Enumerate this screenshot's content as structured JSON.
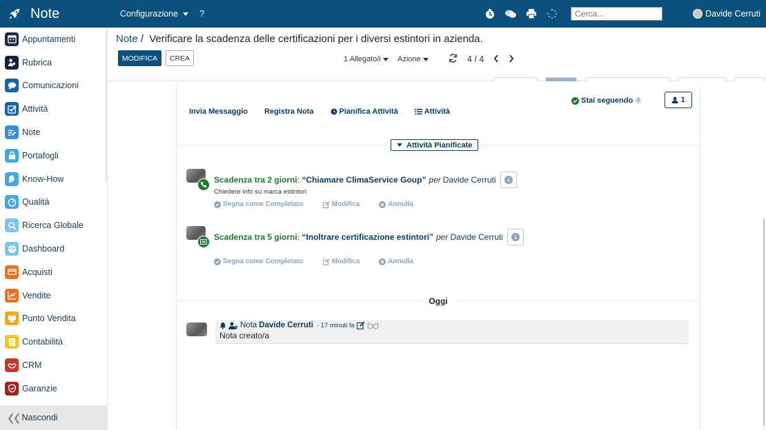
{
  "app": {
    "title": "Note"
  },
  "topnav": {
    "config_label": "Configurazione",
    "help_label": "?"
  },
  "search": {
    "placeholder": "Cerca..."
  },
  "user": {
    "name": "Davide Cerruti"
  },
  "sidebar": {
    "items": [
      {
        "label": "Appuntamenti",
        "icon": "calendar-icon",
        "color": "#1e2b46"
      },
      {
        "label": "Rubrica",
        "icon": "contacts-icon",
        "color": "#13233e"
      },
      {
        "label": "Comunicazioni",
        "icon": "chat-icon",
        "color": "#1565a8"
      },
      {
        "label": "Attività",
        "icon": "checkbox-icon",
        "color": "#1565a8"
      },
      {
        "label": "Note",
        "icon": "note-icon",
        "color": "#3a8fd6"
      },
      {
        "label": "Portafogli",
        "icon": "lock-icon",
        "color": "#43a6e6"
      },
      {
        "label": "Know-How",
        "icon": "brain-icon",
        "color": "#43a6e6"
      },
      {
        "label": "Qualità",
        "icon": "gauge-icon",
        "color": "#43a6e6"
      },
      {
        "label": "Ricerca Globale",
        "icon": "search-icon",
        "color": "#7cc3ee"
      },
      {
        "label": "Dashboard",
        "icon": "dashboard-icon",
        "color": "#7cc3ee"
      },
      {
        "label": "Acquisti",
        "icon": "card-icon",
        "color": "#e8731c"
      },
      {
        "label": "Vendite",
        "icon": "chart-line-icon",
        "color": "#e8731c"
      },
      {
        "label": "Punto Vendita",
        "icon": "pos-icon",
        "color": "#f0a81c"
      },
      {
        "label": "Contabilità",
        "icon": "ledger-icon",
        "color": "#f3c52a"
      },
      {
        "label": "CRM",
        "icon": "handshake-icon",
        "color": "#c0392b"
      },
      {
        "label": "Garanzie",
        "icon": "shield-icon",
        "color": "#a0241c"
      }
    ],
    "hide_label": "Nascondi"
  },
  "header": {
    "breadcrumb_link": "Note",
    "breadcrumb_sep": "/",
    "record_title": "Verificare la scadenza delle certificazioni per i diversi estintori in azienda.",
    "edit_label": "MODIFICA",
    "create_label": "CREA",
    "attachments_label": "1 Allegato/i",
    "action_label": "Azione",
    "pager_label": "4 / 4"
  },
  "chatter": {
    "send_message": "Invia Messaggio",
    "log_note": "Registra Nota",
    "schedule_activity": "Pianifica Attività",
    "activities": "Attività",
    "following": "Stai seguendo",
    "followers_count": "1",
    "planned_label": "Attività Pianificate",
    "today_label": "Oggi"
  },
  "activities": [
    {
      "due": "Scadenza tra 2 giorni",
      "subject": "“Chiamare ClimaService Goup”",
      "by": "per",
      "user": "Davide Cerruti",
      "note": "Chiedere info su marca estintori",
      "icon": "phone-icon"
    },
    {
      "due": "Scadenza tra 5 giorni",
      "subject": "“Inoltrare certificazione estintori”",
      "by": "per",
      "user": "Davide Cerruti",
      "note": "",
      "icon": "form-icon"
    }
  ],
  "activity_ops": {
    "done": "Segna come Completato",
    "edit": "Modifica",
    "cancel": "Annulla"
  },
  "log_entry": {
    "type": "Nota",
    "author": "Davide Cerruti",
    "time": "- 17 minuti fa",
    "body": "Nota creato/a"
  },
  "colors": {
    "brand": "#0b4f7c",
    "due": "#1f7a2e",
    "link": "#0b3b66",
    "muted_op": "#8aa4bf"
  }
}
